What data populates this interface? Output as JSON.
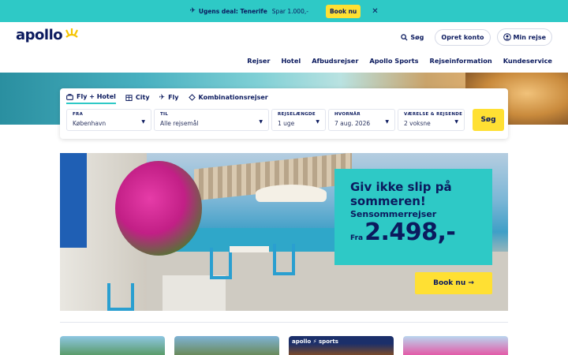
{
  "banner": {
    "deal_label": "Ugens deal: Tenerife",
    "save_text": "Spar 1.000,-",
    "book_button": "Book nu",
    "close_glyph": "✕"
  },
  "header": {
    "logo_text": "apollo",
    "search_label": "Søg",
    "create_account": "Opret konto",
    "my_trip": "Min rejse",
    "nav": [
      "Rejser",
      "Hotel",
      "Afbudsrejser",
      "Apollo Sports",
      "Rejseinformation",
      "Kundeservice"
    ]
  },
  "search": {
    "tabs": [
      {
        "label": "Fly + Hotel",
        "icon": "suitcase-icon"
      },
      {
        "label": "City",
        "icon": "city-icon"
      },
      {
        "label": "Fly",
        "icon": "plane-icon"
      },
      {
        "label": "Kombinationsrejser",
        "icon": "combo-icon"
      }
    ],
    "fields": [
      {
        "label": "FRA",
        "value": "København"
      },
      {
        "label": "TIL",
        "value": "Alle rejsemål"
      },
      {
        "label": "REJSELÆNGDE",
        "value": "1 uge"
      },
      {
        "label": "HVORNÅR",
        "value": "7 aug. 2026"
      },
      {
        "label": "VÆRELSE & REJSENDE",
        "value": "2 voksne"
      }
    ],
    "submit": "Søg"
  },
  "promo": {
    "headline": "Giv ikke slip på sommeren!",
    "subtitle": "Sensommerrejser",
    "from_label": "Fra",
    "price": "2.498,-",
    "button": "Book nu →"
  },
  "cards": {
    "sports_brand": "apollo ⚡ sports"
  },
  "colors": {
    "turquoise": "#2ec9c6",
    "yellow": "#ffe033",
    "navy": "#0b1a5e"
  }
}
